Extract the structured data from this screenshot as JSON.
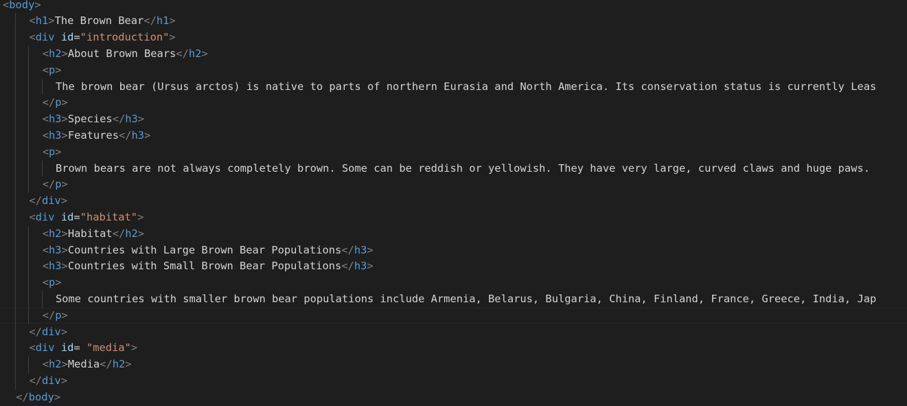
{
  "lines": [
    {
      "indent": 0,
      "tokens": [
        {
          "t": "<",
          "c": "br"
        },
        {
          "t": "body",
          "c": "tag"
        },
        {
          "t": ">",
          "c": "br"
        }
      ]
    },
    {
      "indent": 4,
      "tokens": [
        {
          "t": "<",
          "c": "br"
        },
        {
          "t": "h1",
          "c": "tag"
        },
        {
          "t": ">",
          "c": "br"
        },
        {
          "t": "The Brown Bear",
          "c": "txt"
        },
        {
          "t": "</",
          "c": "br"
        },
        {
          "t": "h1",
          "c": "tag"
        },
        {
          "t": ">",
          "c": "br"
        }
      ]
    },
    {
      "indent": 4,
      "tokens": [
        {
          "t": "<",
          "c": "br"
        },
        {
          "t": "div",
          "c": "tag"
        },
        {
          "t": " ",
          "c": "txt"
        },
        {
          "t": "id",
          "c": "attr"
        },
        {
          "t": "=",
          "c": "txt"
        },
        {
          "t": "\"introduction\"",
          "c": "str"
        },
        {
          "t": ">",
          "c": "br"
        }
      ]
    },
    {
      "indent": 6,
      "tokens": [
        {
          "t": "<",
          "c": "br"
        },
        {
          "t": "h2",
          "c": "tag"
        },
        {
          "t": ">",
          "c": "br"
        },
        {
          "t": "About Brown Bears",
          "c": "txt"
        },
        {
          "t": "</",
          "c": "br"
        },
        {
          "t": "h2",
          "c": "tag"
        },
        {
          "t": ">",
          "c": "br"
        }
      ]
    },
    {
      "indent": 6,
      "tokens": [
        {
          "t": "<",
          "c": "br"
        },
        {
          "t": "p",
          "c": "tag"
        },
        {
          "t": ">",
          "c": "br"
        }
      ]
    },
    {
      "indent": 8,
      "tokens": [
        {
          "t": "The brown bear (Ursus arctos) is native to parts of northern Eurasia and North America. Its conservation status is currently Leas",
          "c": "txt"
        }
      ]
    },
    {
      "indent": 6,
      "tokens": [
        {
          "t": "</",
          "c": "br"
        },
        {
          "t": "p",
          "c": "tag"
        },
        {
          "t": ">",
          "c": "br"
        }
      ]
    },
    {
      "indent": 6,
      "tokens": [
        {
          "t": "<",
          "c": "br"
        },
        {
          "t": "h3",
          "c": "tag"
        },
        {
          "t": ">",
          "c": "br"
        },
        {
          "t": "Species",
          "c": "txt"
        },
        {
          "t": "</",
          "c": "br"
        },
        {
          "t": "h3",
          "c": "tag"
        },
        {
          "t": ">",
          "c": "br"
        }
      ]
    },
    {
      "indent": 6,
      "tokens": [
        {
          "t": "<",
          "c": "br"
        },
        {
          "t": "h3",
          "c": "tag"
        },
        {
          "t": ">",
          "c": "br"
        },
        {
          "t": "Features",
          "c": "txt"
        },
        {
          "t": "</",
          "c": "br"
        },
        {
          "t": "h3",
          "c": "tag"
        },
        {
          "t": ">",
          "c": "br"
        }
      ]
    },
    {
      "indent": 6,
      "tokens": [
        {
          "t": "<",
          "c": "br"
        },
        {
          "t": "p",
          "c": "tag"
        },
        {
          "t": ">",
          "c": "br"
        }
      ]
    },
    {
      "indent": 8,
      "tokens": [
        {
          "t": "Brown bears are not always completely brown. Some can be reddish or yellowish. They have very large, curved claws and huge paws.",
          "c": "txt"
        }
      ]
    },
    {
      "indent": 6,
      "tokens": [
        {
          "t": "</",
          "c": "br"
        },
        {
          "t": "p",
          "c": "tag"
        },
        {
          "t": ">",
          "c": "br"
        }
      ]
    },
    {
      "indent": 4,
      "tokens": [
        {
          "t": "</",
          "c": "br"
        },
        {
          "t": "div",
          "c": "tag"
        },
        {
          "t": ">",
          "c": "br"
        }
      ]
    },
    {
      "indent": 4,
      "tokens": [
        {
          "t": "<",
          "c": "br"
        },
        {
          "t": "div",
          "c": "tag"
        },
        {
          "t": " ",
          "c": "txt"
        },
        {
          "t": "id",
          "c": "attr"
        },
        {
          "t": "=",
          "c": "txt"
        },
        {
          "t": "\"habitat\"",
          "c": "str"
        },
        {
          "t": ">",
          "c": "br"
        }
      ]
    },
    {
      "indent": 6,
      "tokens": [
        {
          "t": "<",
          "c": "br"
        },
        {
          "t": "h2",
          "c": "tag"
        },
        {
          "t": ">",
          "c": "br"
        },
        {
          "t": "Habitat",
          "c": "txt"
        },
        {
          "t": "</",
          "c": "br"
        },
        {
          "t": "h2",
          "c": "tag"
        },
        {
          "t": ">",
          "c": "br"
        }
      ]
    },
    {
      "indent": 6,
      "tokens": [
        {
          "t": "<",
          "c": "br"
        },
        {
          "t": "h3",
          "c": "tag"
        },
        {
          "t": ">",
          "c": "br"
        },
        {
          "t": "Countries with Large Brown Bear Populations",
          "c": "txt"
        },
        {
          "t": "</",
          "c": "br"
        },
        {
          "t": "h3",
          "c": "tag"
        },
        {
          "t": ">",
          "c": "br"
        }
      ]
    },
    {
      "indent": 6,
      "tokens": [
        {
          "t": "<",
          "c": "br"
        },
        {
          "t": "h3",
          "c": "tag"
        },
        {
          "t": ">",
          "c": "br"
        },
        {
          "t": "Countries with Small Brown Bear Populations",
          "c": "txt"
        },
        {
          "t": "</",
          "c": "br"
        },
        {
          "t": "h3",
          "c": "tag"
        },
        {
          "t": ">",
          "c": "br"
        }
      ]
    },
    {
      "indent": 6,
      "tokens": [
        {
          "t": "<",
          "c": "br"
        },
        {
          "t": "p",
          "c": "tag"
        },
        {
          "t": ">",
          "c": "br"
        }
      ]
    },
    {
      "indent": 8,
      "tokens": [
        {
          "t": "Some countries with smaller brown bear populations include Armenia, Belarus, Bulgaria, China, Finland, France, Greece, India, Jap",
          "c": "txt"
        }
      ]
    },
    {
      "indent": 6,
      "current": true,
      "tokens": [
        {
          "t": "</",
          "c": "br"
        },
        {
          "t": "p",
          "c": "tag"
        },
        {
          "t": ">",
          "c": "br"
        }
      ]
    },
    {
      "indent": 4,
      "tokens": [
        {
          "t": "</",
          "c": "br"
        },
        {
          "t": "div",
          "c": "tag"
        },
        {
          "t": ">",
          "c": "br"
        }
      ]
    },
    {
      "indent": 4,
      "tokens": [
        {
          "t": "<",
          "c": "br"
        },
        {
          "t": "div",
          "c": "tag"
        },
        {
          "t": " ",
          "c": "txt"
        },
        {
          "t": "id",
          "c": "attr"
        },
        {
          "t": "= ",
          "c": "txt"
        },
        {
          "t": "\"media\"",
          "c": "str"
        },
        {
          "t": ">",
          "c": "br"
        }
      ]
    },
    {
      "indent": 6,
      "tokens": [
        {
          "t": "<",
          "c": "br"
        },
        {
          "t": "h2",
          "c": "tag"
        },
        {
          "t": ">",
          "c": "br"
        },
        {
          "t": "Media",
          "c": "txt"
        },
        {
          "t": "</",
          "c": "br"
        },
        {
          "t": "h2",
          "c": "tag"
        },
        {
          "t": ">",
          "c": "br"
        }
      ]
    },
    {
      "indent": 4,
      "tokens": [
        {
          "t": "</",
          "c": "br"
        },
        {
          "t": "div",
          "c": "tag"
        },
        {
          "t": ">",
          "c": "br"
        }
      ]
    },
    {
      "indent": 2,
      "tokens": [
        {
          "t": "</",
          "c": "br"
        },
        {
          "t": "body",
          "c": "tag"
        },
        {
          "t": ">",
          "c": "br"
        }
      ]
    }
  ]
}
